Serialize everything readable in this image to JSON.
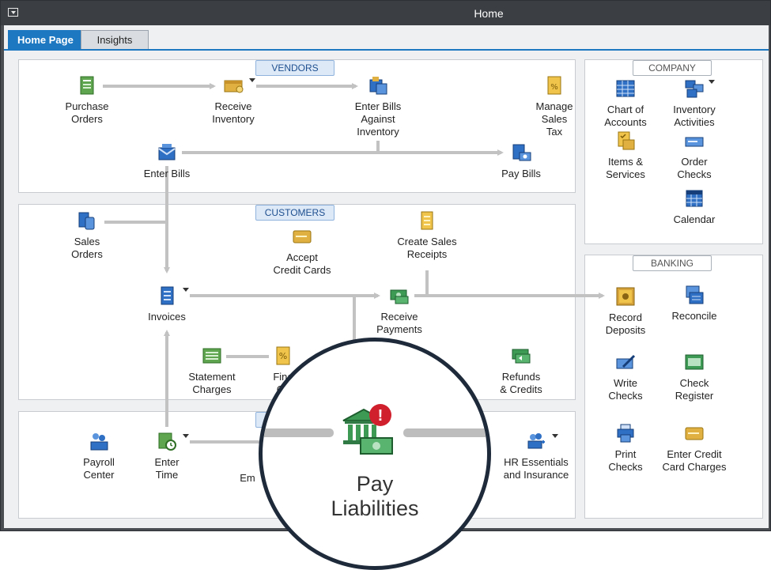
{
  "window": {
    "title": "Home"
  },
  "tabs": [
    {
      "label": "Home Page",
      "active": true
    },
    {
      "label": "Insights",
      "active": false
    }
  ],
  "sections": {
    "vendors": "VENDORS",
    "customers": "CUSTOMERS",
    "company": "COMPANY",
    "banking": "BANKING"
  },
  "vendors": {
    "purchase_orders": "Purchase\nOrders",
    "receive_inventory": "Receive\nInventory",
    "enter_bills_against_inventory": "Enter Bills\nAgainst\nInventory",
    "manage_sales_tax": "Manage\nSales\nTax",
    "enter_bills": "Enter Bills",
    "pay_bills": "Pay Bills"
  },
  "customers": {
    "sales_orders": "Sales\nOrders",
    "accept_credit_cards": "Accept\nCredit Cards",
    "create_sales_receipts": "Create Sales\nReceipts",
    "invoices": "Invoices",
    "receive_payments": "Receive\nPayments",
    "statement_charges": "Statement\nCharges",
    "finance_charges_partial": "Fina\nCh",
    "refunds_credits": "Refunds\n& Credits"
  },
  "employees": {
    "payroll_center": "Payroll\nCenter",
    "enter_time": "Enter\nTime",
    "employees_partial": "Em",
    "hr_essentials": "HR Essentials\nand Insurance"
  },
  "company": {
    "chart_of_accounts": "Chart of\nAccounts",
    "inventory_activities": "Inventory\nActivities",
    "items_services": "Items &\nServices",
    "order_checks": "Order\nChecks",
    "calendar": "Calendar"
  },
  "banking": {
    "record_deposits": "Record\nDeposits",
    "reconcile": "Reconcile",
    "write_checks": "Write\nChecks",
    "check_register": "Check\nRegister",
    "print_checks": "Print\nChecks",
    "enter_credit_card_charges": "Enter Credit\nCard Charges"
  },
  "magnifier": {
    "label": "Pay\nLiabilities",
    "alert_glyph": "!"
  },
  "colors": {
    "accent": "#1d78c1",
    "flow_arrow": "#c2c2c2",
    "alert": "#d0202e"
  }
}
